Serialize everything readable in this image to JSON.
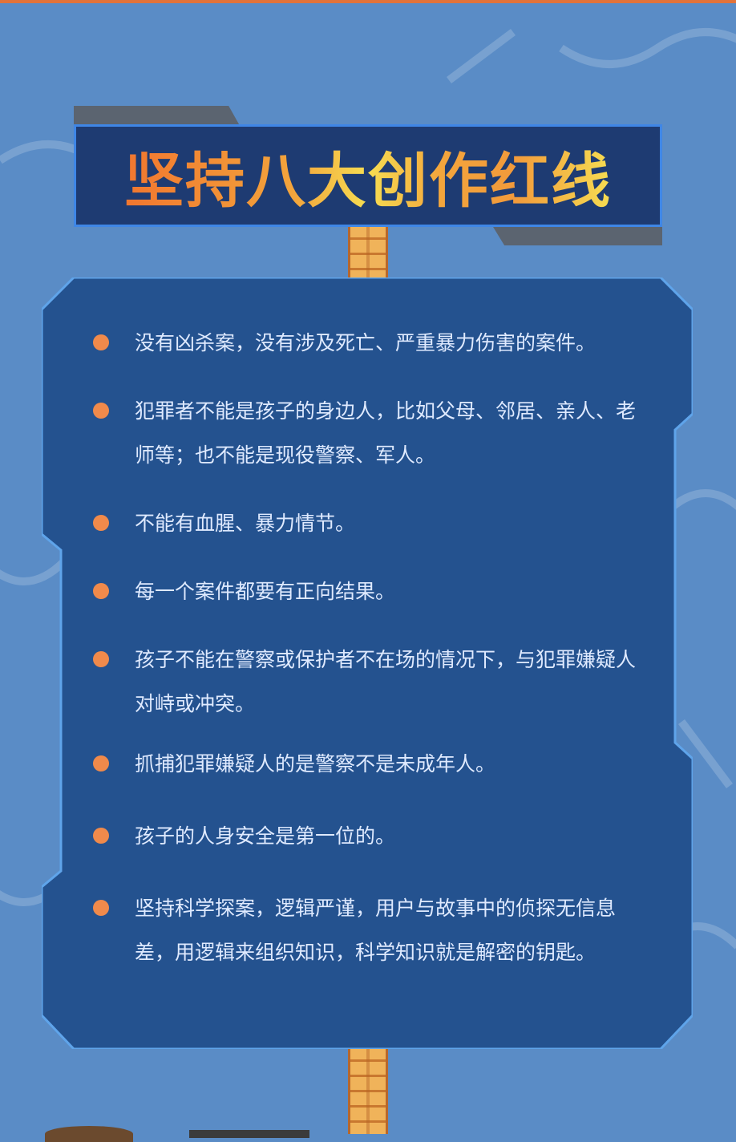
{
  "title": "坚持八大创作红线",
  "rules": [
    "没有凶杀案，没有涉及死亡、严重暴力伤害的案件。",
    "犯罪者不能是孩子的身边人，比如父母、邻居、亲人、老师等；也不能是现役警察、军人。",
    "不能有血腥、暴力情节。",
    "每一个案件都要有正向结果。",
    "孩子不能在警察或保护者不在场的情况下，与犯罪嫌疑人对峙或冲突。",
    "抓捕犯罪嫌疑人的是警察不是未成年人。",
    "孩子的人身安全是第一位的。",
    "坚持科学探案，逻辑严谨，用户与故事中的侦探无信息差，用逻辑来组织知识，科学知识就是解密的钥匙。"
  ],
  "colors": {
    "background": "#5a8cc6",
    "panel": "#24528f",
    "title_box": "#1e3b72",
    "bullet": "#f08a4b",
    "text": "#dfeaff"
  }
}
